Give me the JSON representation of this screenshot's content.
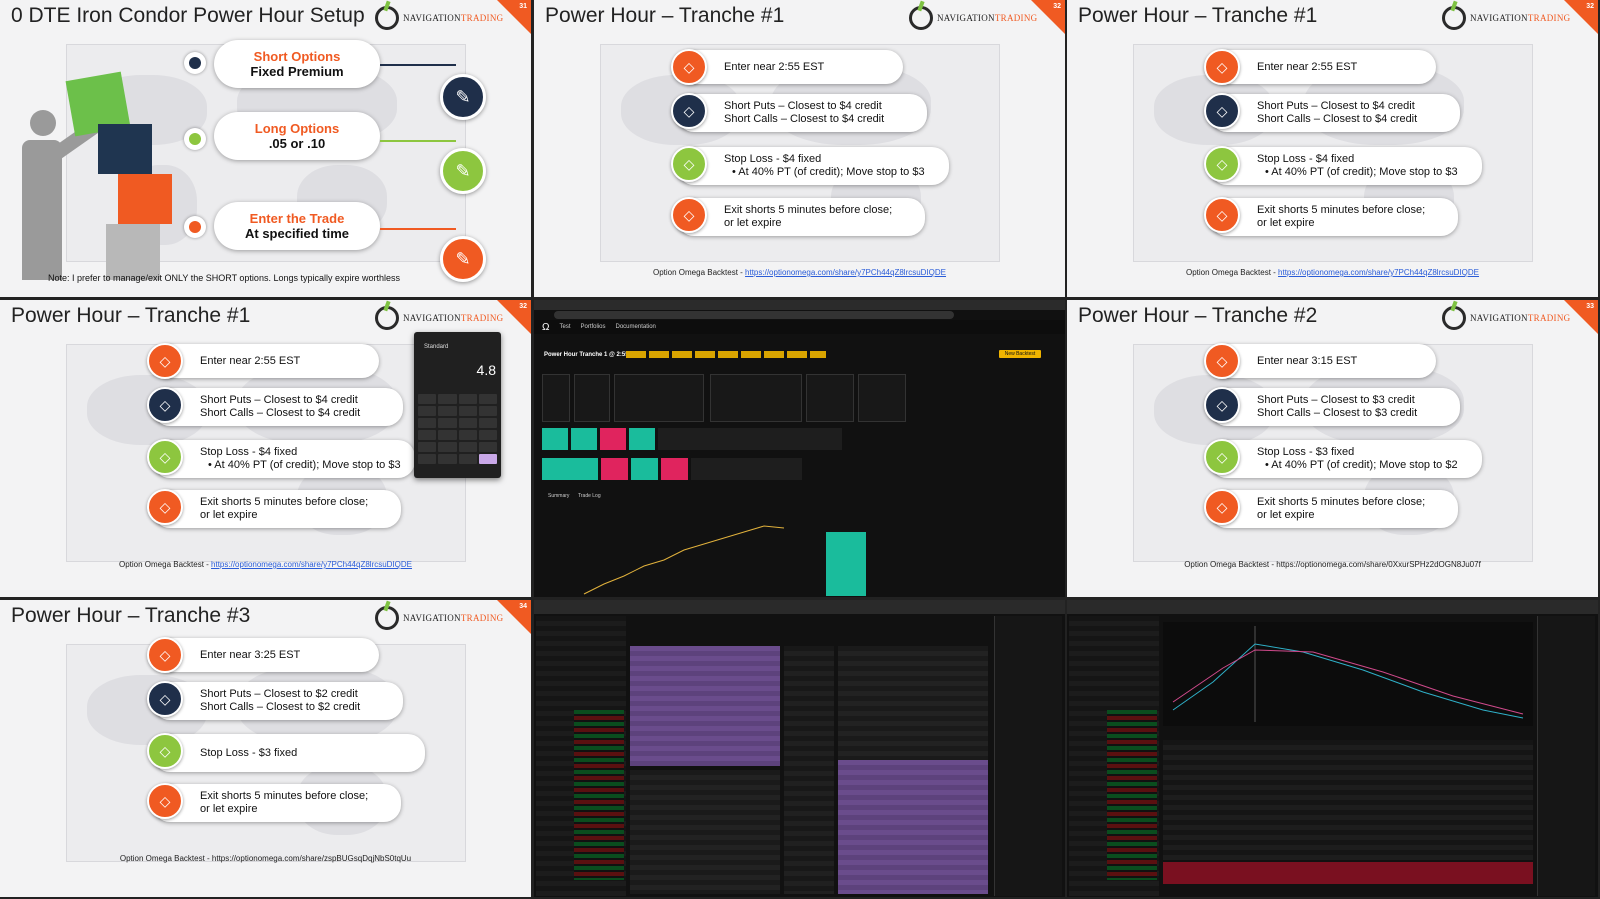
{
  "tile0": {
    "title": "0 DTE Iron Condor Power Hour Setup",
    "logo": {
      "a": "NAVIGATION",
      "b": "TRADING"
    },
    "slide": "31",
    "steps": [
      {
        "l1": "Short Options",
        "l2": "Fixed Premium"
      },
      {
        "l1": "Long Options",
        "l2": ".05 or .10"
      },
      {
        "l1": "Enter the Trade",
        "l2": "At specified time"
      }
    ],
    "note": "Note: I prefer to manage/exit ONLY the SHORT options. Longs typically expire worthless"
  },
  "tile1": {
    "title": "Power Hour – Tranche #1",
    "slide": "32",
    "rows": [
      {
        "a": "Enter near 2:55 EST"
      },
      {
        "a": "Short Puts – Closest to $4 credit",
        "b": "Short Calls – Closest to $4 credit"
      },
      {
        "a": "Stop Loss - $4 fixed",
        "b": "•  At 40% PT (of credit); Move stop to $3"
      },
      {
        "a": "Exit shorts 5 minutes before close;",
        "b": "or let expire"
      }
    ],
    "foot_label": "Option Omega Backtest - ",
    "foot_link": "https://optionomega.com/share/y7PCh44qZ8lrcsuDIQDE"
  },
  "tile2": {
    "title": "Power Hour – Tranche #1",
    "slide": "32",
    "rows": [
      {
        "a": "Enter near 2:55 EST"
      },
      {
        "a": "Short Puts – Closest to $4 credit",
        "b": "Short Calls – Closest to $4 credit"
      },
      {
        "a": "Stop Loss - $4 fixed",
        "b": "•  At 40% PT (of credit); Move stop to $3"
      },
      {
        "a": "Exit shorts 5 minutes before close;",
        "b": "or let expire"
      }
    ],
    "foot_label": "Option Omega Backtest - ",
    "foot_link": "https://optionomega.com/share/y7PCh44qZ8lrcsuDIQDE"
  },
  "tile3": {
    "title": "Power Hour – Tranche #1",
    "slide": "32",
    "rows": [
      {
        "a": "Enter near 2:55 EST"
      },
      {
        "a": "Short Puts – Closest to $4 credit",
        "b": "Short Calls – Closest to $4 credit"
      },
      {
        "a": "Stop Loss - $4 fixed",
        "b": "•  At 40% PT (of credit); Move stop to $3"
      },
      {
        "a": "Exit shorts 5 minutes before close;",
        "b": "or let expire"
      }
    ],
    "foot_label": "Option Omega Backtest - ",
    "foot_link": "https://optionomega.com/share/y7PCh44qZ8lrcsuDIQDE",
    "calc": {
      "mode": "Standard",
      "value": "4.8"
    }
  },
  "tile4": {
    "brand": "Ω",
    "nav": [
      "Test",
      "Portfolios",
      "Documentation"
    ],
    "heading": "Power Hour Tranche 1 @ 2:55 EST",
    "btn": "New Backtest",
    "tabs": [
      "Summary",
      "Trade Log"
    ]
  },
  "tile5": {
    "title": "Power Hour – Tranche #2",
    "slide": "33",
    "rows": [
      {
        "a": "Enter near 3:15 EST"
      },
      {
        "a": "Short Puts – Closest to $3 credit",
        "b": "Short Calls – Closest to $3 credit"
      },
      {
        "a": "Stop Loss - $3 fixed",
        "b": "•  At 40% PT (of credit); Move stop to $2"
      },
      {
        "a": "Exit shorts 5 minutes before close;",
        "b": "or let expire"
      }
    ],
    "foot_label": "Option Omega Backtest - https://optionomega.com/share/0XxurSPHz2dOGN8Ju07f"
  },
  "tile6": {
    "title": "Power Hour – Tranche #3",
    "slide": "34",
    "rows": [
      {
        "a": "Enter near 3:25 EST"
      },
      {
        "a": "Short Puts – Closest to $2 credit",
        "b": "Short Calls – Closest to $2 credit"
      },
      {
        "a": "Stop Loss - $3 fixed"
      },
      {
        "a": "Exit shorts 5 minutes before close;",
        "b": "or let expire"
      }
    ],
    "foot_label": "Option Omega Backtest - https://optionomega.com/share/zspBUGsqDqjNbS0tqUu"
  },
  "icons": {
    "row": "diamond-icon",
    "edit": "pencil-square-icon"
  },
  "colors": {
    "orange": "#f05a22",
    "navy": "#1f2f4a",
    "green": "#8dc63f",
    "teal": "#1abc9c"
  }
}
